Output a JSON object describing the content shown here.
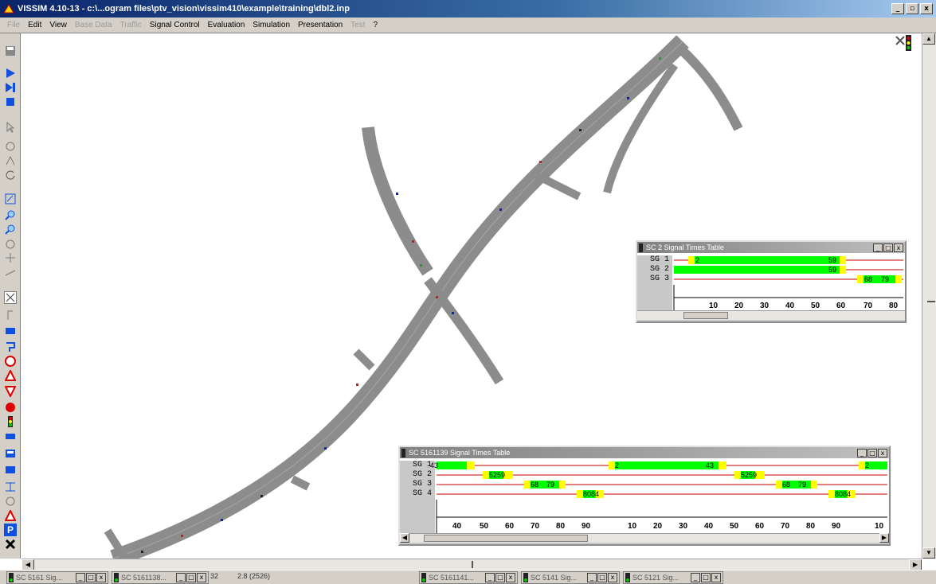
{
  "window": {
    "title": "VISSIM 4.10-13 - c:\\...ogram files\\ptv_vision\\vissim410\\example\\training\\dbl2.inp",
    "min": "_",
    "max": "̲□",
    "close": "x"
  },
  "menu": [
    {
      "label": "File",
      "enabled": false
    },
    {
      "label": "Edit",
      "enabled": true
    },
    {
      "label": "View",
      "enabled": true
    },
    {
      "label": "Base Data",
      "enabled": false
    },
    {
      "label": "Traffic",
      "enabled": false
    },
    {
      "label": "Signal Control",
      "enabled": true
    },
    {
      "label": "Evaluation",
      "enabled": true
    },
    {
      "label": "Simulation",
      "enabled": true
    },
    {
      "label": "Presentation",
      "enabled": true
    },
    {
      "label": "Test",
      "enabled": false
    },
    {
      "label": "?",
      "enabled": true
    }
  ],
  "toolbar_icons": [
    "save-icon",
    "run-icon",
    "step-icon",
    "stop-icon",
    "select-icon",
    "rotate-icon",
    "zoom-in-icon",
    "zoom-out-icon",
    "pan-icon",
    "move-icon",
    "measure-icon",
    "link-tool-icon",
    "vehicle-input-icon",
    "routing-icon",
    "speed-icon",
    "warning-icon",
    "yield-icon",
    "stop-sign-icon",
    "signal-head-icon",
    "detector-icon",
    "transit-stop-icon",
    "parking-lot-icon",
    "node-icon",
    "conflict-icon",
    "priority-icon",
    "parking-icon",
    "close-tool-icon"
  ],
  "colors": {
    "road": "#8c8c8c",
    "green": "#00ff00",
    "amber": "#ffff00",
    "red": "#cc0000"
  },
  "stt_sc2": {
    "title": "SC 2 Signal Times Table",
    "axis_ticks": [
      "10",
      "20",
      "30",
      "40",
      "50",
      "60",
      "70",
      "80"
    ],
    "groups": [
      {
        "label": "SG 1",
        "marks": [
          "2",
          "59"
        ]
      },
      {
        "label": "SG 2",
        "marks": [
          "59"
        ]
      },
      {
        "label": "SG 3",
        "marks": [
          "68",
          "79"
        ]
      }
    ]
  },
  "stt_sc5161139": {
    "title": "SC 5161139 Signal Times Table",
    "axis_ticks": [
      "40",
      "50",
      "60",
      "70",
      "80",
      "90",
      "10",
      "20",
      "30",
      "40",
      "50",
      "60",
      "70",
      "80",
      "90",
      "10"
    ],
    "groups": [
      {
        "label": "SG 1",
        "marks": [
          "43",
          "2",
          "43",
          "2"
        ]
      },
      {
        "label": "SG 2",
        "marks": [
          "5259",
          "5259"
        ]
      },
      {
        "label": "SG 3",
        "marks": [
          "68",
          "79",
          "68",
          "79"
        ]
      },
      {
        "label": "SG 4",
        "marks": [
          "8084",
          "8084"
        ]
      }
    ]
  },
  "taskbar": [
    {
      "label": "SC 5161 Sig..."
    },
    {
      "label": "SC 5161138..."
    },
    {
      "label": "SC 5161141..."
    },
    {
      "label": "SC 5141 Sig..."
    },
    {
      "label": "SC 5121 Sig..."
    }
  ],
  "status": {
    "coord": "32",
    "time": "2.8 (2526)"
  }
}
